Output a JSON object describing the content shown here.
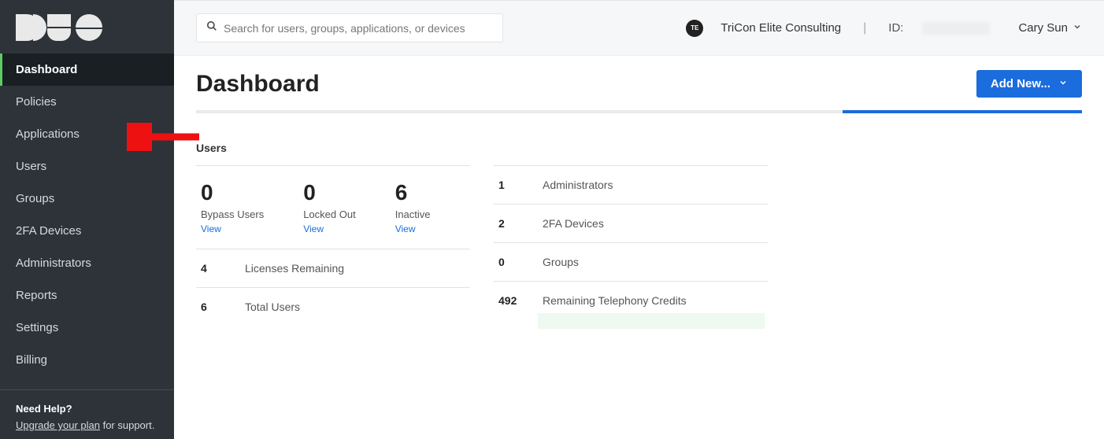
{
  "sidebar": {
    "items": [
      {
        "label": "Dashboard"
      },
      {
        "label": "Policies"
      },
      {
        "label": "Applications"
      },
      {
        "label": "Users"
      },
      {
        "label": "Groups"
      },
      {
        "label": "2FA Devices"
      },
      {
        "label": "Administrators"
      },
      {
        "label": "Reports"
      },
      {
        "label": "Settings"
      },
      {
        "label": "Billing"
      }
    ],
    "help_title": "Need Help?",
    "help_upgrade_link": "Upgrade your plan",
    "help_upgrade_suffix": " for support."
  },
  "topbar": {
    "search_placeholder": "Search for users, groups, applications, or devices",
    "badge": "TE",
    "account_name": "TriCon Elite Consulting",
    "id_label": "ID:",
    "user_name": "Cary Sun"
  },
  "page": {
    "title": "Dashboard",
    "add_new_label": "Add New...",
    "progress_percent": 27
  },
  "users_section": {
    "title": "Users",
    "tiles": [
      {
        "value": "0",
        "label": "Bypass Users",
        "link": "View"
      },
      {
        "value": "0",
        "label": "Locked Out",
        "link": "View"
      },
      {
        "value": "6",
        "label": "Inactive",
        "link": "View"
      }
    ],
    "rows": [
      {
        "value": "4",
        "label": "Licenses Remaining"
      },
      {
        "value": "6",
        "label": "Total Users"
      }
    ]
  },
  "summary_section": {
    "rows": [
      {
        "value": "1",
        "label": "Administrators"
      },
      {
        "value": "2",
        "label": "2FA Devices"
      },
      {
        "value": "0",
        "label": "Groups"
      },
      {
        "value": "492",
        "label": "Remaining Telephony Credits"
      }
    ]
  }
}
